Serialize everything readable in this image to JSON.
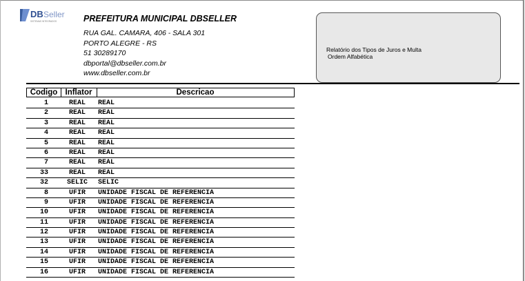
{
  "logo": {
    "text_db": "DB",
    "text_seller": "Seller",
    "tagline": "SISTEMAS INTEGRADOS"
  },
  "header": {
    "title": "PREFEITURA MUNICIPAL DBSELLER",
    "address": "RUA GAL. CAMARA, 406 - SALA 301",
    "city": "PORTO ALEGRE - RS",
    "phone": "51 30289170",
    "email": "dbportal@dbseller.com.br",
    "site": "www.dbseller.com.br"
  },
  "info": {
    "report_title": "Relatório dos Tipos de Juros e Multa",
    "order": "Ordem Alfabética"
  },
  "table": {
    "headers": {
      "codigo": "Codigo",
      "inflator": "Inflator",
      "descricao": "Descricao"
    },
    "rows": [
      {
        "codigo": "1",
        "inflator": "REAL",
        "descricao": "REAL"
      },
      {
        "codigo": "2",
        "inflator": "REAL",
        "descricao": "REAL"
      },
      {
        "codigo": "3",
        "inflator": "REAL",
        "descricao": "REAL"
      },
      {
        "codigo": "4",
        "inflator": "REAL",
        "descricao": "REAL"
      },
      {
        "codigo": "5",
        "inflator": "REAL",
        "descricao": "REAL"
      },
      {
        "codigo": "6",
        "inflator": "REAL",
        "descricao": "REAL"
      },
      {
        "codigo": "7",
        "inflator": "REAL",
        "descricao": "REAL"
      },
      {
        "codigo": "33",
        "inflator": "REAL",
        "descricao": "REAL"
      },
      {
        "codigo": "32",
        "inflator": "SELIC",
        "descricao": "SELIC"
      },
      {
        "codigo": "8",
        "inflator": "UFIR",
        "descricao": "UNIDADE FISCAL DE REFERENCIA"
      },
      {
        "codigo": "9",
        "inflator": "UFIR",
        "descricao": "UNIDADE FISCAL DE REFERENCIA"
      },
      {
        "codigo": "10",
        "inflator": "UFIR",
        "descricao": "UNIDADE FISCAL DE REFERENCIA"
      },
      {
        "codigo": "11",
        "inflator": "UFIR",
        "descricao": "UNIDADE FISCAL DE REFERENCIA"
      },
      {
        "codigo": "12",
        "inflator": "UFIR",
        "descricao": "UNIDADE FISCAL DE REFERENCIA"
      },
      {
        "codigo": "13",
        "inflator": "UFIR",
        "descricao": "UNIDADE FISCAL DE REFERENCIA"
      },
      {
        "codigo": "14",
        "inflator": "UFIR",
        "descricao": "UNIDADE FISCAL DE REFERENCIA"
      },
      {
        "codigo": "15",
        "inflator": "UFIR",
        "descricao": "UNIDADE FISCAL DE REFERENCIA"
      },
      {
        "codigo": "16",
        "inflator": "UFIR",
        "descricao": "UNIDADE FISCAL DE REFERENCIA"
      }
    ]
  }
}
